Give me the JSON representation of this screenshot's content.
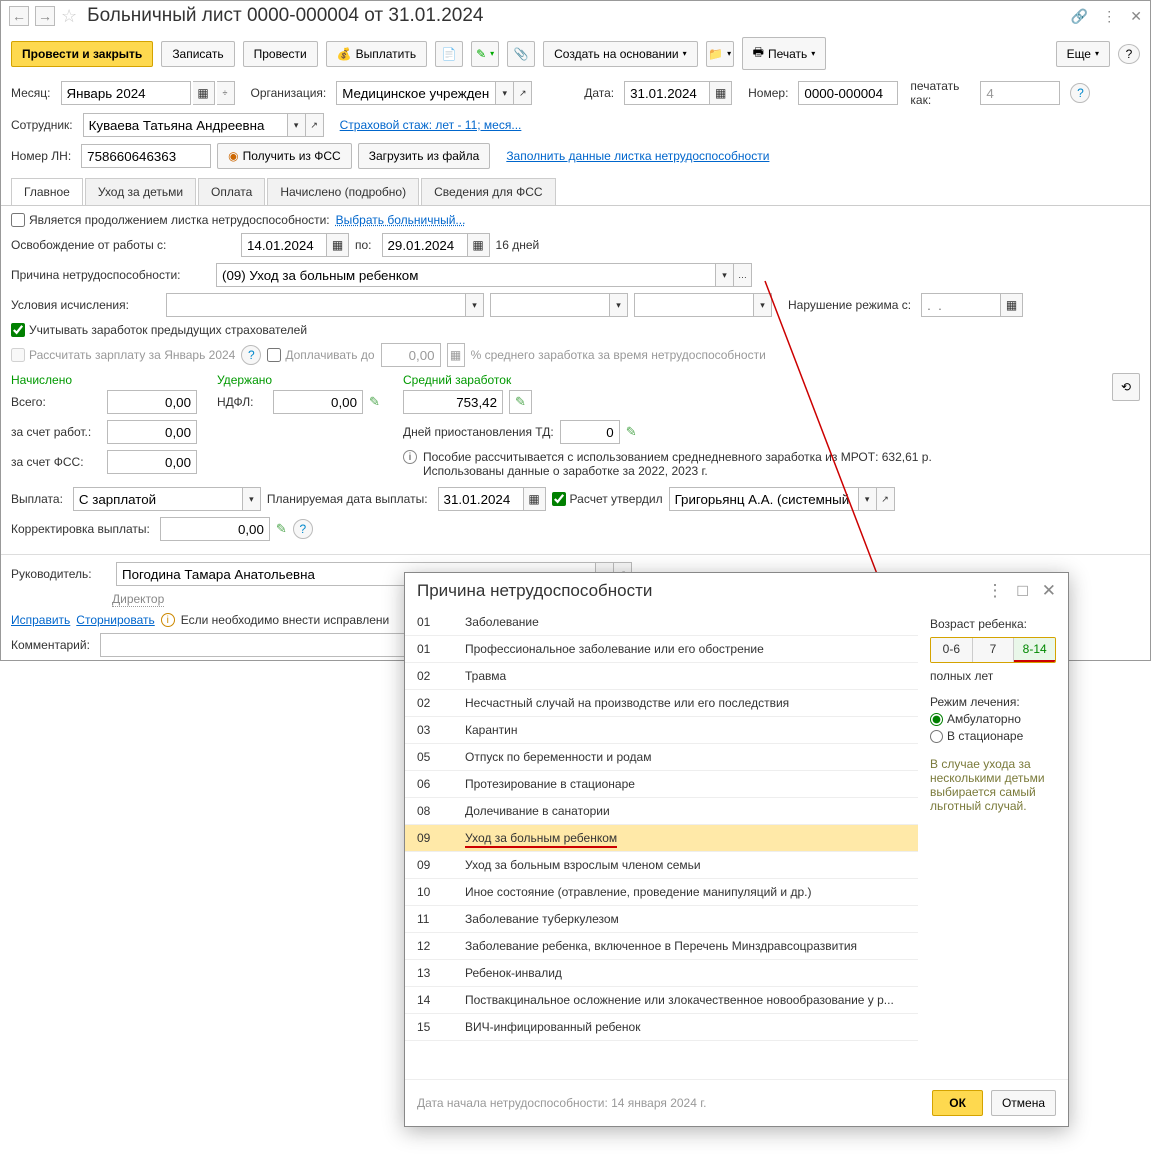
{
  "title": "Больничный лист 0000-000004 от 31.01.2024",
  "toolbar": {
    "post_close": "Провести и закрыть",
    "record": "Записать",
    "post": "Провести",
    "pay": "Выплатить",
    "create_based": "Создать на основании",
    "print": "Печать",
    "more": "Еще"
  },
  "form": {
    "month_label": "Месяц:",
    "month_value": "Январь 2024",
    "org_label": "Организация:",
    "org_value": "Медицинское учреждение",
    "date_label": "Дата:",
    "date_value": "31.01.2024",
    "number_label": "Номер:",
    "number_value": "0000-000004",
    "print_as": "печатать как:",
    "print_as_value": "4",
    "employee_label": "Сотрудник:",
    "employee_value": "Куваева Татьяна Андреевна",
    "insurance_link": "Страховой стаж: лет - 11; меся...",
    "ln_label": "Номер ЛН:",
    "ln_value": "758660646363",
    "get_fss": "Получить из ФСС",
    "load_file": "Загрузить из файла",
    "fill_link": "Заполнить данные листка нетрудоспособности"
  },
  "tabs": [
    "Главное",
    "Уход за детьми",
    "Оплата",
    "Начислено (подробно)",
    "Сведения для ФСС"
  ],
  "tab_main": {
    "continuation": "Является продолжением листка нетрудоспособности:",
    "select_sick": "Выбрать больничный...",
    "release_label": "Освобождение от работы с:",
    "date_from": "14.01.2024",
    "date_to_label": "по:",
    "date_to": "29.01.2024",
    "days": "16 дней",
    "reason_label": "Причина нетрудоспособности:",
    "reason_value": "(09) Уход за больным ребенком",
    "conditions_label": "Условия исчисления:",
    "violation_label": "Нарушение режима с:",
    "account_prev": "Учитывать заработок предыдущих страхователей",
    "calc_salary": "Рассчитать зарплату за Январь 2024",
    "doplach": "Доплачивать до",
    "doplach_val": "0,00",
    "avg_percent": "% среднего заработка за время нетрудоспособности",
    "accrued": "Начислено",
    "withheld": "Удержано",
    "avg_earn": "Средний заработок",
    "total": "Всего:",
    "total_v": "0,00",
    "ndfl": "НДФЛ:",
    "ndfl_v": "0,00",
    "avg_v": "753,42",
    "by_employer": "за счет работ.:",
    "by_employer_v": "0,00",
    "suspend_days": "Дней приостановления ТД:",
    "suspend_v": "0",
    "by_fss": "за счет ФСС:",
    "by_fss_v": "0,00",
    "benefit_info": "Пособие рассчитывается с использованием среднедневного заработка из МРОТ:  632,61 р.",
    "benefit_info2": "Использованы данные о заработке за  2022,  2023 г.",
    "payment_label": "Выплата:",
    "payment_value": "С зарплатой",
    "planned_date": "Планируемая дата выплаты:",
    "planned_date_v": "31.01.2024",
    "approved": "Расчет утвердил",
    "approved_v": "Григорьянц А.А. (системный адми",
    "correction": "Корректировка выплаты:",
    "correction_v": "0,00"
  },
  "footer": {
    "manager_label": "Руководитель:",
    "manager": "Погодина Тамара Анатольевна",
    "director": "Директор",
    "fix": "Исправить",
    "storno": "Сторнировать",
    "info": "Если необходимо внести исправлени",
    "comment": "Комментарий:"
  },
  "modal": {
    "title": "Причина нетрудоспособности",
    "reasons": [
      {
        "code": "01",
        "name": "Заболевание"
      },
      {
        "code": "01",
        "name": "Профессиональное заболевание или его обострение"
      },
      {
        "code": "02",
        "name": "Травма"
      },
      {
        "code": "02",
        "name": "Несчастный случай на производстве или его последствия"
      },
      {
        "code": "03",
        "name": "Карантин"
      },
      {
        "code": "05",
        "name": "Отпуск по беременности и родам"
      },
      {
        "code": "06",
        "name": "Протезирование в стационаре"
      },
      {
        "code": "08",
        "name": "Долечивание в санатории"
      },
      {
        "code": "09",
        "name": "Уход за больным ребенком"
      },
      {
        "code": "09",
        "name": "Уход за больным взрослым членом семьи"
      },
      {
        "code": "10",
        "name": "Иное состояние (отравление, проведение манипуляций и др.)"
      },
      {
        "code": "11",
        "name": "Заболевание туберкулезом"
      },
      {
        "code": "12",
        "name": "Заболевание ребенка, включенное в Перечень Минздравсоцразвития"
      },
      {
        "code": "13",
        "name": "Ребенок-инвалид"
      },
      {
        "code": "14",
        "name": "Поствакцинальное осложнение или злокачественное новообразование у р..."
      },
      {
        "code": "15",
        "name": "ВИЧ-инфицированный ребенок"
      }
    ],
    "selected_index": 8,
    "age_label": "Возраст ребенка:",
    "age_opts": [
      "0-6",
      "7",
      "8-14"
    ],
    "age_unit": "полных лет",
    "treatment_label": "Режим лечения:",
    "treatment_opts": [
      "Амбулаторно",
      "В стационаре"
    ],
    "note": "В случае ухода за несколькими детьми выбирается самый льготный случай.",
    "start_date": "Дата начала нетрудоспособности: 14 января 2024 г.",
    "ok": "ОК",
    "cancel": "Отмена"
  }
}
